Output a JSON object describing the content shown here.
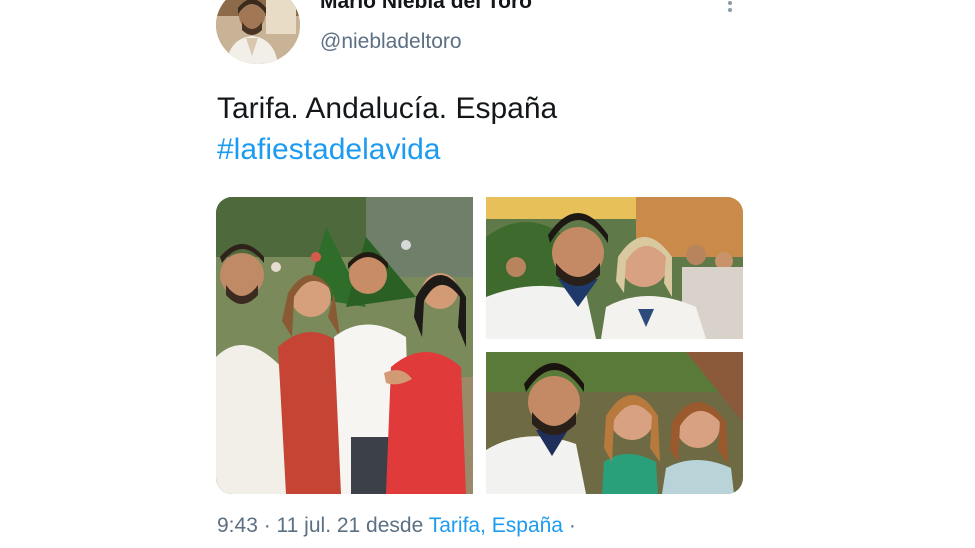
{
  "author": {
    "display_name": "Mario Niebla del Toro",
    "handle": "@niebladeltoro",
    "avatar_icon": "user-avatar"
  },
  "menu": {
    "icon": "more-vertical-icon"
  },
  "tweet": {
    "text_line1": "Tarifa. Andalucía. España",
    "hashtag": "#lafiestadelavida"
  },
  "media": {
    "photo_count": 3
  },
  "meta": {
    "time": "9:43",
    "sep1": " · ",
    "date": "11 jul. 21",
    "from_word": " desde ",
    "place": "Tarifa, España",
    "sep2": " ·"
  },
  "colors": {
    "link": "#1d9bf0",
    "secondary_text": "#5b7083",
    "primary_text": "#14171a"
  }
}
